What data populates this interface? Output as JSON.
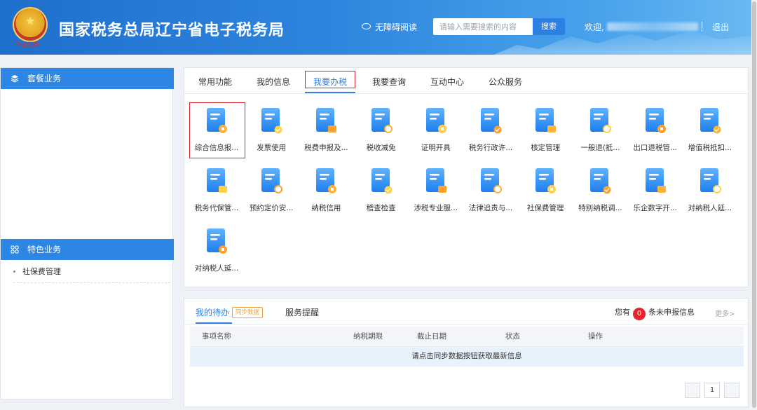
{
  "header": {
    "seal_text": "中国税务",
    "title": "国家税务总局辽宁省电子税务局",
    "accessibility": "无障碍阅读",
    "search_placeholder": "请输入需要搜索的内容",
    "search_button": "搜索",
    "welcome": "欢迎,",
    "logout": "退出"
  },
  "sidebar": {
    "package_title": "套餐业务",
    "featured_title": "特色业务",
    "featured_items": [
      "社保费管理"
    ]
  },
  "main": {
    "tabs": [
      "常用功能",
      "我的信息",
      "我要办税",
      "我要查询",
      "互动中心",
      "公众服务"
    ],
    "active_tab": "我要办税",
    "items": [
      {
        "label": "综合信息报...",
        "icon": "report-doc-icon",
        "selected": true
      },
      {
        "label": "发票使用",
        "icon": "invoice-icon"
      },
      {
        "label": "税费申报及...",
        "icon": "tax-declare-icon"
      },
      {
        "label": "税收减免",
        "icon": "tax-reduction-icon"
      },
      {
        "label": "证明开具",
        "icon": "certificate-icon"
      },
      {
        "label": "税务行政许...",
        "icon": "admin-permit-icon"
      },
      {
        "label": "核定管理",
        "icon": "verification-icon"
      },
      {
        "label": "一般退(抵...",
        "icon": "refund-icon"
      },
      {
        "label": "出口退税管...",
        "icon": "export-refund-icon"
      },
      {
        "label": "增值税抵扣...",
        "icon": "vat-deduct-icon"
      },
      {
        "label": "税务代保管...",
        "icon": "custody-icon"
      },
      {
        "label": "预约定价安...",
        "icon": "pricing-arrangement-icon"
      },
      {
        "label": "纳税信用",
        "icon": "tax-credit-icon"
      },
      {
        "label": "稽查检查",
        "icon": "inspection-icon"
      },
      {
        "label": "涉税专业服...",
        "icon": "professional-service-icon"
      },
      {
        "label": "法律追责与...",
        "icon": "legal-icon"
      },
      {
        "label": "社保费管理",
        "icon": "social-security-icon"
      },
      {
        "label": "特别纳税调...",
        "icon": "special-adjust-icon"
      },
      {
        "label": "乐企数字开...",
        "icon": "digital-invoice-icon"
      },
      {
        "label": "对纳税人延...",
        "icon": "extension-icon"
      },
      {
        "label": "对纳税人延...",
        "icon": "extension-icon"
      }
    ]
  },
  "todo": {
    "tab_todo": "我的待办",
    "sync_tag": "同步数据",
    "tab_reminder": "服务提醒",
    "unreported_prefix": "您有",
    "unreported_count": "0",
    "unreported_suffix": "条未申报信息",
    "more": "更多>",
    "columns": [
      "事项名称",
      "纳税期限",
      "截止日期",
      "状态",
      "操作"
    ],
    "empty_message": "请点击同步数据按钮获取最新信息",
    "page": "1"
  },
  "colors": {
    "primary": "#2d7fe0",
    "highlight_red": "#d9262c",
    "header_blue": "#1f6fcd"
  }
}
